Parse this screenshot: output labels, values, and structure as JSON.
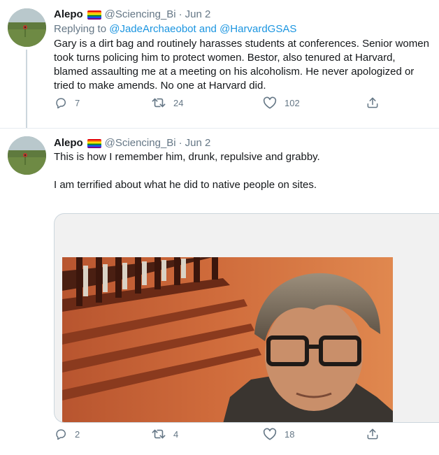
{
  "tweets": [
    {
      "author_name": "Alepo",
      "handle": "@Sciencing_Bi",
      "separator": "·",
      "date": "Jun 2",
      "replying_prefix": "Replying to",
      "replying_handle_1": "@JadeArchaeobot",
      "replying_and": "and",
      "replying_handle_2": "@HarvardGSAS",
      "text": "Gary is a dirt bag and routinely harasses students at conferences. Senior women took turns policing him to protect women. Bestor, also tenured at Harvard, blamed assaulting me at a meeting on his alcoholism. He never apologized or tried to make amends. No one at Harvard did.",
      "reply_count": "7",
      "retweet_count": "24",
      "like_count": "102"
    },
    {
      "author_name": "Alepo",
      "handle": "@Sciencing_Bi",
      "separator": "·",
      "date": "Jun 2",
      "text_line_1": "This is how I remember him, drunk, repulsive and grabby.",
      "text_line_2": "I am terrified about what he did to native people on sites.",
      "reply_count": "2",
      "retweet_count": "4",
      "like_count": "18"
    }
  ],
  "icons": {
    "flag": "rainbow-flag-icon",
    "reply": "reply-icon",
    "retweet": "retweet-icon",
    "like": "heart-icon",
    "share": "share-icon"
  },
  "colors": {
    "link": "#1b95e0",
    "muted": "#657786",
    "text": "#14171a",
    "divider": "#e6ecf0"
  }
}
